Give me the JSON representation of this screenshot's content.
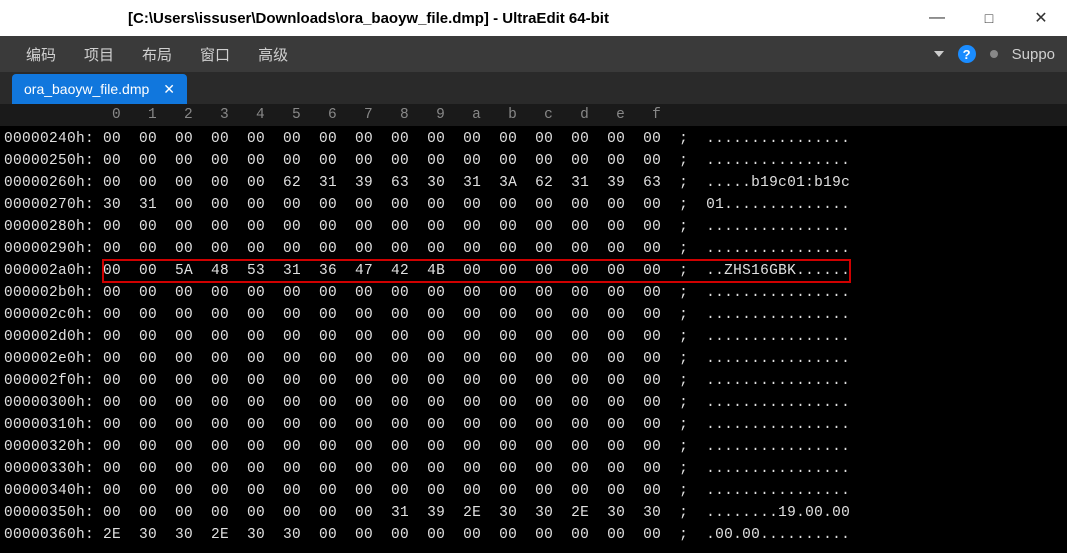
{
  "titlebar": {
    "title": "[C:\\Users\\issuser\\Downloads\\ora_baoyw_file.dmp] - UltraEdit 64-bit"
  },
  "window_controls": {
    "minimize": "—",
    "maximize": "□",
    "close": "✕"
  },
  "menu": {
    "encoding": "编码",
    "project": "项目",
    "layout": "布局",
    "window": "窗口",
    "advanced": "高级"
  },
  "menubar_right": {
    "help": "?",
    "support": "Suppo"
  },
  "tab": {
    "label": "ora_baoyw_file.dmp",
    "close": "✕"
  },
  "ruler": "            0   1   2   3   4   5   6   7   8   9   a   b   c   d   e   f",
  "rows": [
    {
      "addr": "00000240h:",
      "hex": "00  00  00  00  00  00  00  00  00  00  00  00  00  00  00  00",
      "asc": "................",
      "hl": false
    },
    {
      "addr": "00000250h:",
      "hex": "00  00  00  00  00  00  00  00  00  00  00  00  00  00  00  00",
      "asc": "................",
      "hl": false
    },
    {
      "addr": "00000260h:",
      "hex": "00  00  00  00  00  62  31  39  63  30  31  3A  62  31  39  63",
      "asc": ".....b19c01:b19c",
      "hl": false
    },
    {
      "addr": "00000270h:",
      "hex": "30  31  00  00  00  00  00  00  00  00  00  00  00  00  00  00",
      "asc": "01..............",
      "hl": false
    },
    {
      "addr": "00000280h:",
      "hex": "00  00  00  00  00  00  00  00  00  00  00  00  00  00  00  00",
      "asc": "................",
      "hl": false
    },
    {
      "addr": "00000290h:",
      "hex": "00  00  00  00  00  00  00  00  00  00  00  00  00  00  00  00",
      "asc": "................",
      "hl": false
    },
    {
      "addr": "000002a0h:",
      "hex": "00  00  5A  48  53  31  36  47  42  4B  00  00  00  00  00  00",
      "asc": "..ZHS16GBK......",
      "hl": true
    },
    {
      "addr": "000002b0h:",
      "hex": "00  00  00  00  00  00  00  00  00  00  00  00  00  00  00  00",
      "asc": "................",
      "hl": false
    },
    {
      "addr": "000002c0h:",
      "hex": "00  00  00  00  00  00  00  00  00  00  00  00  00  00  00  00",
      "asc": "................",
      "hl": false
    },
    {
      "addr": "000002d0h:",
      "hex": "00  00  00  00  00  00  00  00  00  00  00  00  00  00  00  00",
      "asc": "................",
      "hl": false
    },
    {
      "addr": "000002e0h:",
      "hex": "00  00  00  00  00  00  00  00  00  00  00  00  00  00  00  00",
      "asc": "................",
      "hl": false
    },
    {
      "addr": "000002f0h:",
      "hex": "00  00  00  00  00  00  00  00  00  00  00  00  00  00  00  00",
      "asc": "................",
      "hl": false
    },
    {
      "addr": "00000300h:",
      "hex": "00  00  00  00  00  00  00  00  00  00  00  00  00  00  00  00",
      "asc": "................",
      "hl": false
    },
    {
      "addr": "00000310h:",
      "hex": "00  00  00  00  00  00  00  00  00  00  00  00  00  00  00  00",
      "asc": "................",
      "hl": false
    },
    {
      "addr": "00000320h:",
      "hex": "00  00  00  00  00  00  00  00  00  00  00  00  00  00  00  00",
      "asc": "................",
      "hl": false
    },
    {
      "addr": "00000330h:",
      "hex": "00  00  00  00  00  00  00  00  00  00  00  00  00  00  00  00",
      "asc": "................",
      "hl": false
    },
    {
      "addr": "00000340h:",
      "hex": "00  00  00  00  00  00  00  00  00  00  00  00  00  00  00  00",
      "asc": "................",
      "hl": false
    },
    {
      "addr": "00000350h:",
      "hex": "00  00  00  00  00  00  00  00  31  39  2E  30  30  2E  30  30",
      "asc": "........19.00.00",
      "hl": false
    },
    {
      "addr": "00000360h:",
      "hex": "2E  30  30  2E  30  30  00  00  00  00  00  00  00  00  00  00",
      "asc": ".00.00..........",
      "hl": false
    }
  ]
}
